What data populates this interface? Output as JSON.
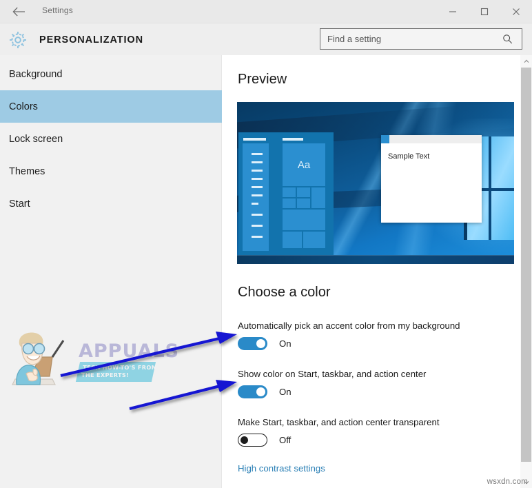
{
  "window": {
    "title": "Settings",
    "back_icon": "back-arrow-icon",
    "minimize_icon": "minimize-icon",
    "maximize_icon": "maximize-icon",
    "close_icon": "close-icon"
  },
  "header": {
    "gear_icon": "gear-icon",
    "title": "PERSONALIZATION"
  },
  "search": {
    "placeholder": "Find a setting",
    "value": "",
    "icon": "search-icon"
  },
  "sidebar": {
    "items": [
      {
        "label": "Background",
        "selected": false
      },
      {
        "label": "Colors",
        "selected": true
      },
      {
        "label": "Lock screen",
        "selected": false
      },
      {
        "label": "Themes",
        "selected": false
      },
      {
        "label": "Start",
        "selected": false
      }
    ]
  },
  "watermark": {
    "brand": "APPUALS",
    "tagline_line1": "TECH HOW-TO'S FROM",
    "tagline_line2": "THE EXPERTS!",
    "corner": "wsxdn.com"
  },
  "main": {
    "preview_heading": "Preview",
    "choose_heading": "Choose a color",
    "preview": {
      "tile_label": "Aa",
      "sample_window_text": "Sample Text"
    },
    "settings": [
      {
        "label": "Automatically pick an accent color from my background",
        "state": "On",
        "on": true
      },
      {
        "label": "Show color on Start, taskbar, and action center",
        "state": "On",
        "on": true
      },
      {
        "label": "Make Start, taskbar, and action center transparent",
        "state": "Off",
        "on": false
      }
    ],
    "high_contrast_link": "High contrast settings"
  },
  "colors": {
    "accent": "#2a8ac8",
    "selected_nav": "#9ecbe4",
    "link": "#2a7fb5",
    "titlebar": "#e9e9e9",
    "sidebar": "#f1f1f1",
    "annotation_arrow": "#1414d2"
  },
  "scrollbar": {
    "up_icon": "chevron-up-icon",
    "down_icon": "chevron-down-icon"
  }
}
